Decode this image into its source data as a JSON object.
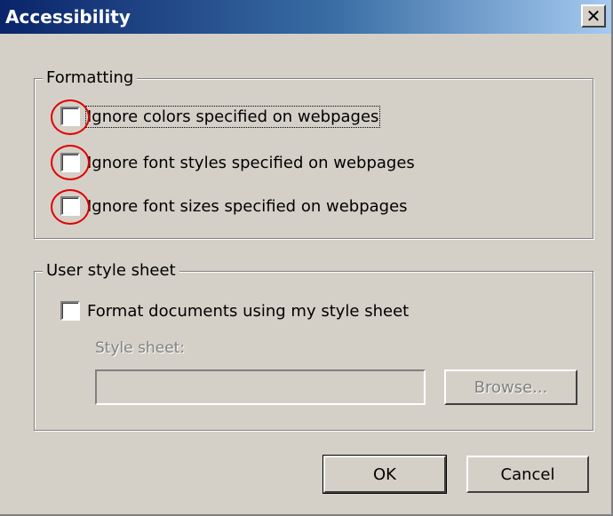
{
  "window": {
    "title": "Accessibility",
    "close_glyph": "✕"
  },
  "formatting": {
    "legend": "Formatting",
    "options": [
      {
        "label": "Ignore colors specified on webpages",
        "checked": false
      },
      {
        "label": "Ignore font styles specified on webpages",
        "checked": false
      },
      {
        "label": "Ignore font sizes specified on webpages",
        "checked": false
      }
    ]
  },
  "user_style": {
    "legend": "User style sheet",
    "format_label": "Format documents using my style sheet",
    "style_sheet_label": "Style sheet:",
    "style_sheet_value": "",
    "browse_label": "Browse..."
  },
  "buttons": {
    "ok": "OK",
    "cancel": "Cancel"
  },
  "annotation_color": "#e00000"
}
